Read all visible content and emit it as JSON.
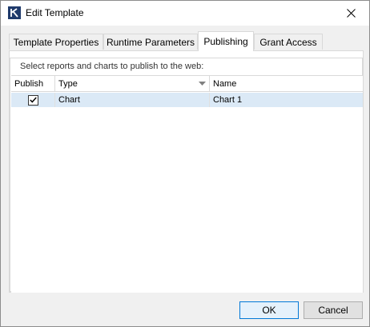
{
  "window": {
    "title": "Edit Template"
  },
  "tabs": [
    {
      "label": "Template Properties"
    },
    {
      "label": "Runtime Parameters"
    },
    {
      "label": "Publishing"
    },
    {
      "label": "Grant Access"
    }
  ],
  "active_tab": "Publishing",
  "group": {
    "label": "Select reports and charts to publish to the web:"
  },
  "table": {
    "headers": {
      "publish": "Publish",
      "type": "Type",
      "name": "Name"
    },
    "rows": [
      {
        "publish": true,
        "type": "Chart",
        "name": "Chart 1"
      }
    ]
  },
  "buttons": {
    "ok": "OK",
    "cancel": "Cancel"
  },
  "icons": {
    "app": "app-logo-icon",
    "close": "close-icon",
    "sort": "sort-down-icon",
    "check": "checkmark-icon"
  },
  "colors": {
    "selection": "#dbe9f6",
    "accent": "#0078d7"
  }
}
